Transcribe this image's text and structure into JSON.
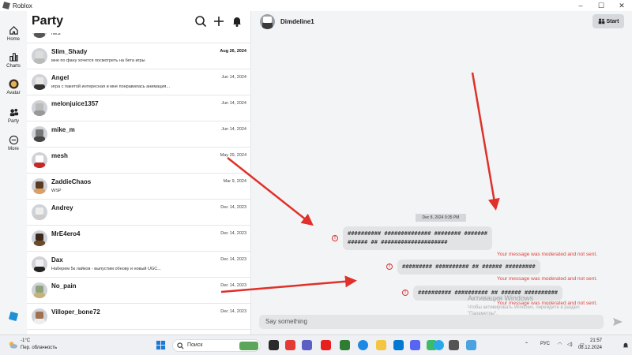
{
  "window": {
    "title": "Roblox"
  },
  "nav": {
    "items": [
      {
        "label": "Home"
      },
      {
        "label": "Charts"
      },
      {
        "label": "Avatar"
      },
      {
        "label": "Party"
      },
      {
        "label": "More"
      }
    ]
  },
  "party": {
    "title": "Party",
    "conversations": [
      {
        "name": "",
        "preview": "пись",
        "date": ""
      },
      {
        "name": "Slim_Shady",
        "preview": "мне по фану хочется посмотреть на бета игры",
        "date": "Aug 26, 2024"
      },
      {
        "name": "Angel",
        "preview": "игра с пакетой интересная и мне понравилась анимация...",
        "date": "Jun 14, 2024"
      },
      {
        "name": "melonjuice1357",
        "preview": "",
        "date": "Jun 14, 2024"
      },
      {
        "name": "mike_m",
        "preview": "",
        "date": "Jun 14, 2024"
      },
      {
        "name": "mesh",
        "preview": "",
        "date": "May 29, 2024"
      },
      {
        "name": "ZaddieChaos",
        "preview": "WSP",
        "date": "Mar 9, 2024"
      },
      {
        "name": "Andrey",
        "preview": "",
        "date": "Dec 14, 2023"
      },
      {
        "name": "MrE4ero4",
        "preview": "",
        "date": "Dec 14, 2023"
      },
      {
        "name": "Dax",
        "preview": "Наберем 5к лайков - выпустим обнову и новый UGC...",
        "date": "Dec 14, 2023"
      },
      {
        "name": "No_pain",
        "preview": "",
        "date": "Dec 14, 2023"
      },
      {
        "name": "Villoper_bone72",
        "preview": "",
        "date": "Dec 14, 2023"
      }
    ]
  },
  "chat": {
    "contact": "Dimdeline1",
    "start_label": "Start",
    "date_separator": "Dec 8, 2024 9:35 PM",
    "messages": [
      {
        "text_line1": "########## ############## ######## #######",
        "text_line2": "###### ## ####################",
        "status": "Your message was moderated and not sent."
      },
      {
        "text_line1": "######### ########## ## ###### #########",
        "status": "Your message was moderated and not sent."
      },
      {
        "text_line1": "########## ########## ## ###### ##########",
        "status": "Your message was moderated and not sent."
      }
    ],
    "composer_placeholder": "Say something"
  },
  "watermark": {
    "title": "Активация Windows",
    "line1": "Чтобы активировать Windows, перейдите в раздел",
    "line2": "\"Параметры\"."
  },
  "taskbar": {
    "temperature": "-1°C",
    "condition": "Пер. облачность",
    "search_label": "Поиск",
    "language": "РУС",
    "time": "21:57",
    "date": "08.12.2024"
  },
  "colors": {
    "accent_red": "#e0443e",
    "arrow_red": "#e0302a"
  }
}
